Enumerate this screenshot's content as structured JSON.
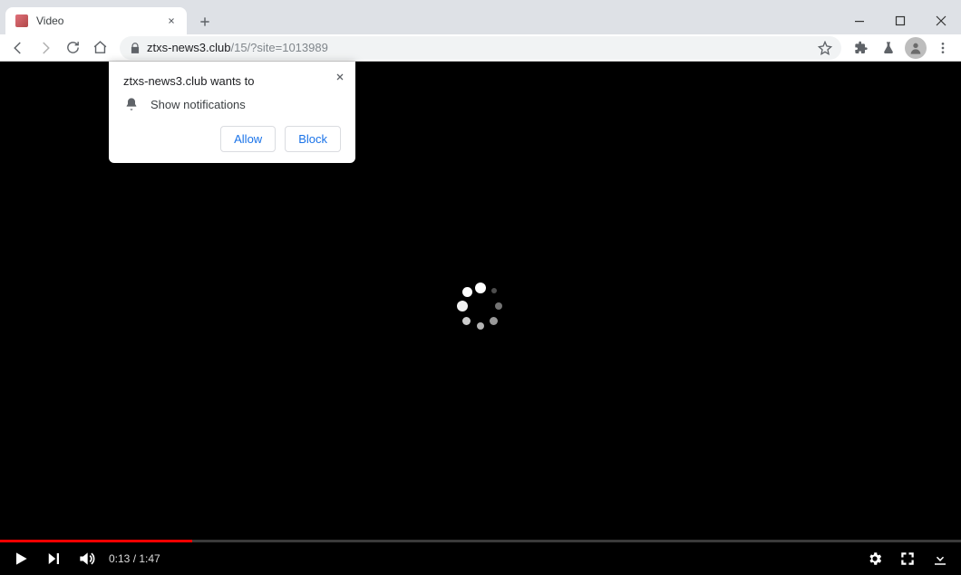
{
  "window": {
    "tab_title": "Video",
    "url_host": "ztxs-news3.club",
    "url_path": "/15/?site=1013989"
  },
  "prompt": {
    "title": "ztxs-news3.club wants to",
    "permission_label": "Show notifications",
    "allow_label": "Allow",
    "block_label": "Block"
  },
  "player": {
    "current_time": "0:13",
    "duration": "1:47",
    "progress_fraction": 0.2
  }
}
